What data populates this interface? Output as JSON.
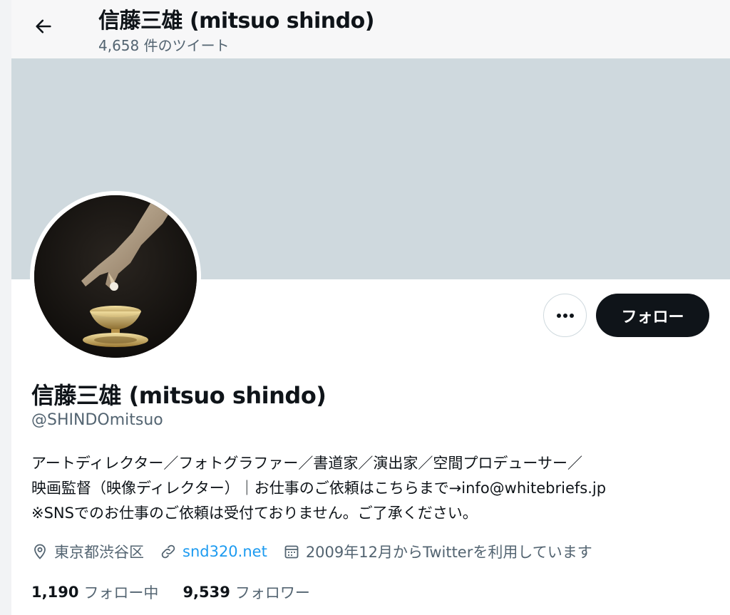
{
  "header": {
    "title": "信藤三雄 (mitsuo shindo)",
    "tweet_count": "4,658 件のツイート"
  },
  "profile": {
    "display_name": "信藤三雄 (mitsuo shindo)",
    "handle": "@SHINDOmitsuo",
    "bio_lines": [
      "アートディレクター／フォトグラファー／書道家／演出家／空間プロデューサー／",
      "映画監督（映像ディレクター）｜お仕事のご依頼はこちらまで→info@whitebriefs.jp",
      "※SNSでのお仕事のご依頼は受付ておりません。ご了承ください。"
    ],
    "location": "東京都渋谷区",
    "website": "snd320.net",
    "joined": "2009年12月からTwitterを利用しています"
  },
  "actions": {
    "follow_label": "フォロー"
  },
  "stats": {
    "following_count": "1,190",
    "following_label": "フォロー中",
    "followers_count": "9,539",
    "followers_label": "フォロワー"
  },
  "icons": {
    "back": "arrow-left-icon",
    "more": "more-horizontal-icon",
    "location": "location-pin-icon",
    "link": "link-icon",
    "calendar": "calendar-icon"
  },
  "colors": {
    "banner": "#cfd9de",
    "link": "#1d9bf0",
    "secondary_text": "#536471",
    "follow_button": "#0f1419"
  }
}
